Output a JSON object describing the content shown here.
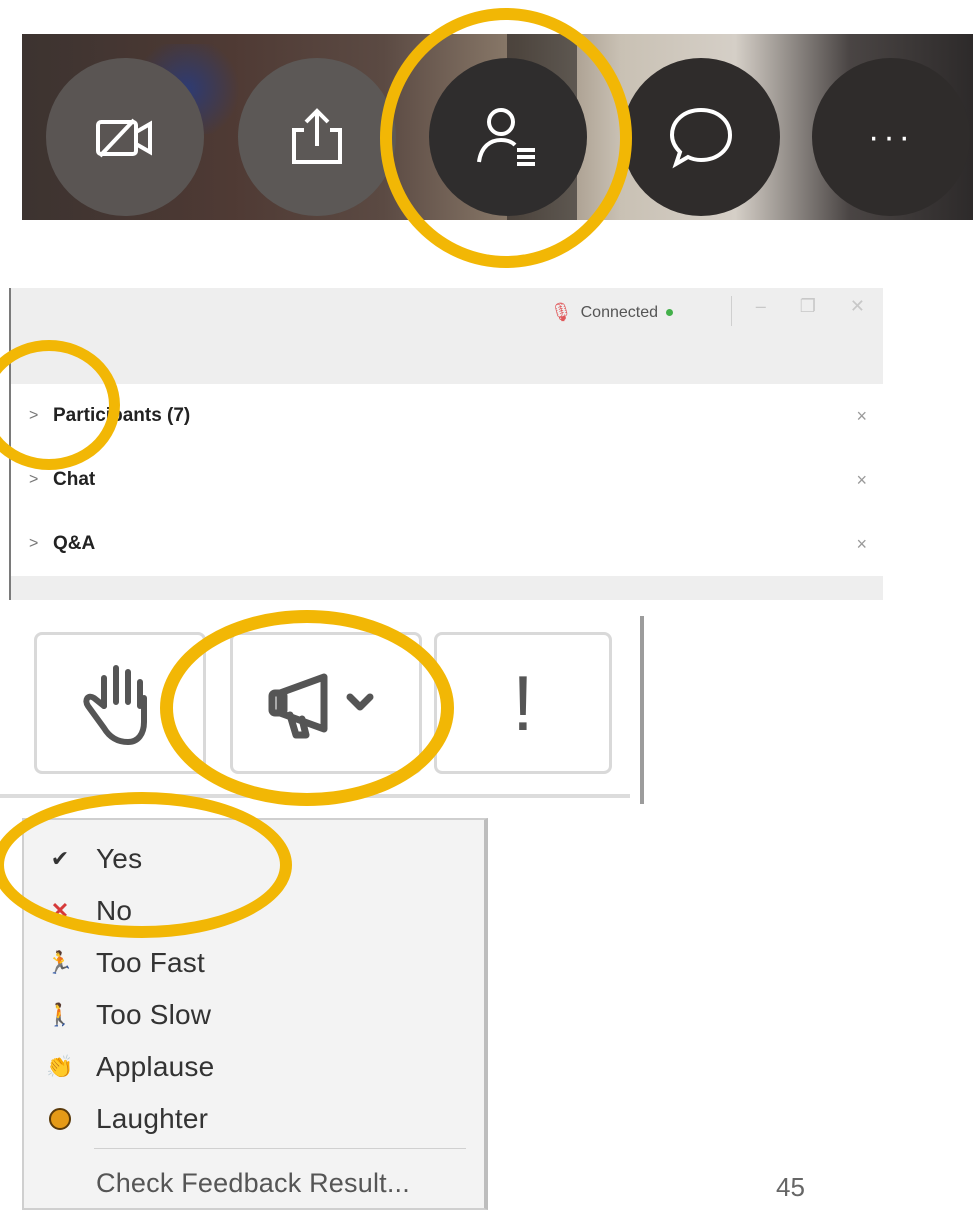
{
  "toolbar": {
    "buttons": [
      {
        "id": "video",
        "icon": "video-off-icon"
      },
      {
        "id": "share",
        "icon": "share-icon"
      },
      {
        "id": "participants",
        "icon": "participants-icon"
      },
      {
        "id": "chat",
        "icon": "chat-icon"
      },
      {
        "id": "more",
        "icon": "more-icon",
        "label": "···"
      }
    ]
  },
  "panel": {
    "status": "Connected",
    "rows": [
      {
        "label": "Participants (7)",
        "chevron": ">",
        "close": "×"
      },
      {
        "label": "Chat",
        "chevron": ">",
        "close": "×"
      },
      {
        "label": "Q&A",
        "chevron": ">",
        "close": "×"
      }
    ]
  },
  "feedback": {
    "alert_label": "!"
  },
  "menu": {
    "items": [
      {
        "label": "Yes",
        "icon": "check-icon"
      },
      {
        "label": "No",
        "icon": "x-icon"
      },
      {
        "label": "Too Fast",
        "icon": "runner-icon"
      },
      {
        "label": "Too Slow",
        "icon": "walker-icon"
      },
      {
        "label": "Applause",
        "icon": "applause-icon"
      },
      {
        "label": "Laughter",
        "icon": "laughter-icon"
      }
    ],
    "footer_item": "Check Feedback Result..."
  },
  "page_number": "45",
  "colors": {
    "highlight": "#f2b705",
    "status_dot": "#43b04a",
    "no_icon": "#d63a3a",
    "check_icon": "#333333"
  }
}
